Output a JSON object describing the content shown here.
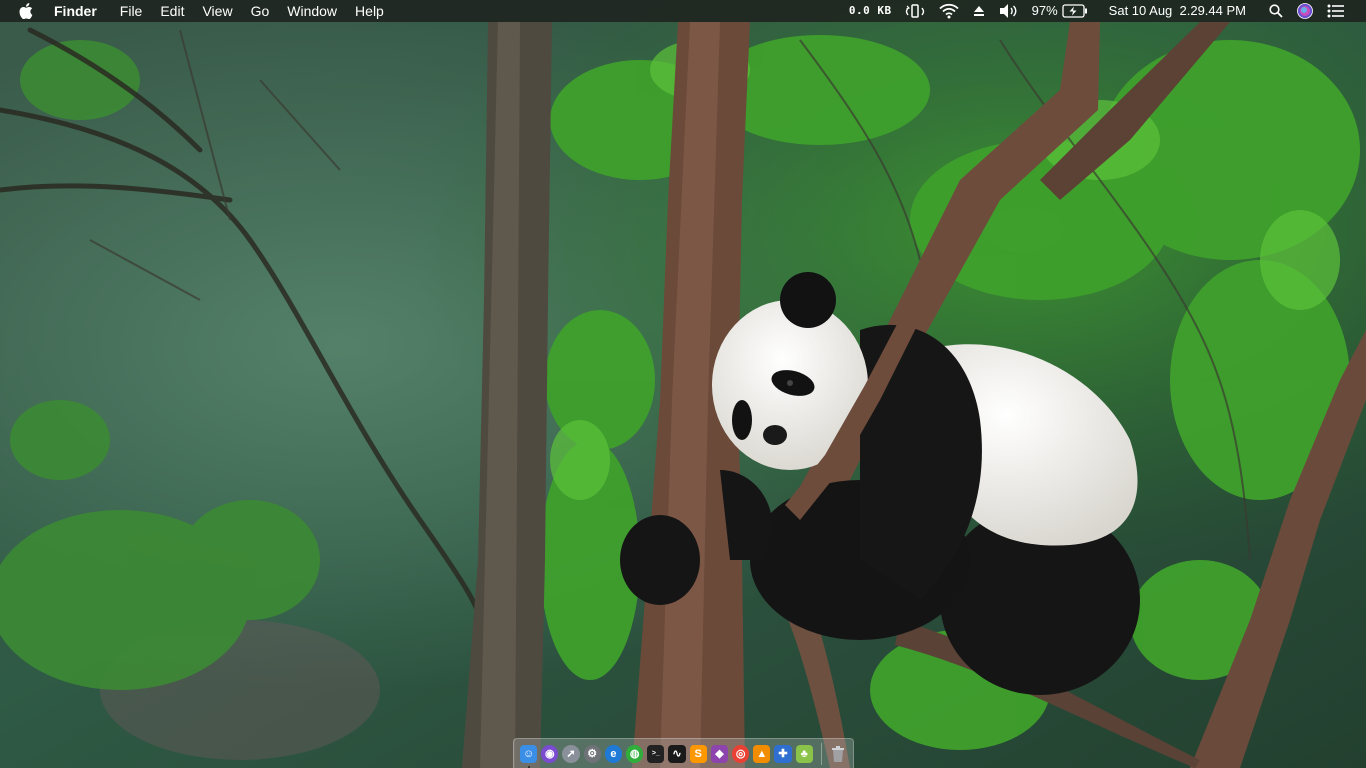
{
  "menubar": {
    "app_name": "Finder",
    "menus": [
      "File",
      "Edit",
      "View",
      "Go",
      "Window",
      "Help"
    ],
    "network_speed": "0.0 KB",
    "battery_percent": "97%",
    "datetime": "Sat 10 Aug  2.29.44 PM"
  },
  "dock": {
    "items": [
      {
        "name": "finder-icon",
        "color": "#3a8ee6"
      },
      {
        "name": "siri-icon",
        "color": "#7a4ccf"
      },
      {
        "name": "launchpad-icon",
        "color": "#8a9099"
      },
      {
        "name": "system-preferences-icon",
        "color": "#6f7378"
      },
      {
        "name": "internet-explorer-icon",
        "color": "#1e7ad6"
      },
      {
        "name": "globe-browser-icon",
        "color": "#2fae3b"
      },
      {
        "name": "terminal-icon",
        "color": "#222222"
      },
      {
        "name": "activity-monitor-icon",
        "color": "#1a1a1a"
      },
      {
        "name": "sublime-text-icon",
        "color": "#ff9800"
      },
      {
        "name": "github-desktop-icon",
        "color": "#8e44ad"
      },
      {
        "name": "chrome-icon",
        "color": "#e94235"
      },
      {
        "name": "vlc-icon",
        "color": "#f28c00"
      },
      {
        "name": "xcode-icon",
        "color": "#2e6fd1"
      },
      {
        "name": "android-studio-icon",
        "color": "#8bc34a"
      }
    ],
    "trash": {
      "name": "trash-icon"
    }
  }
}
